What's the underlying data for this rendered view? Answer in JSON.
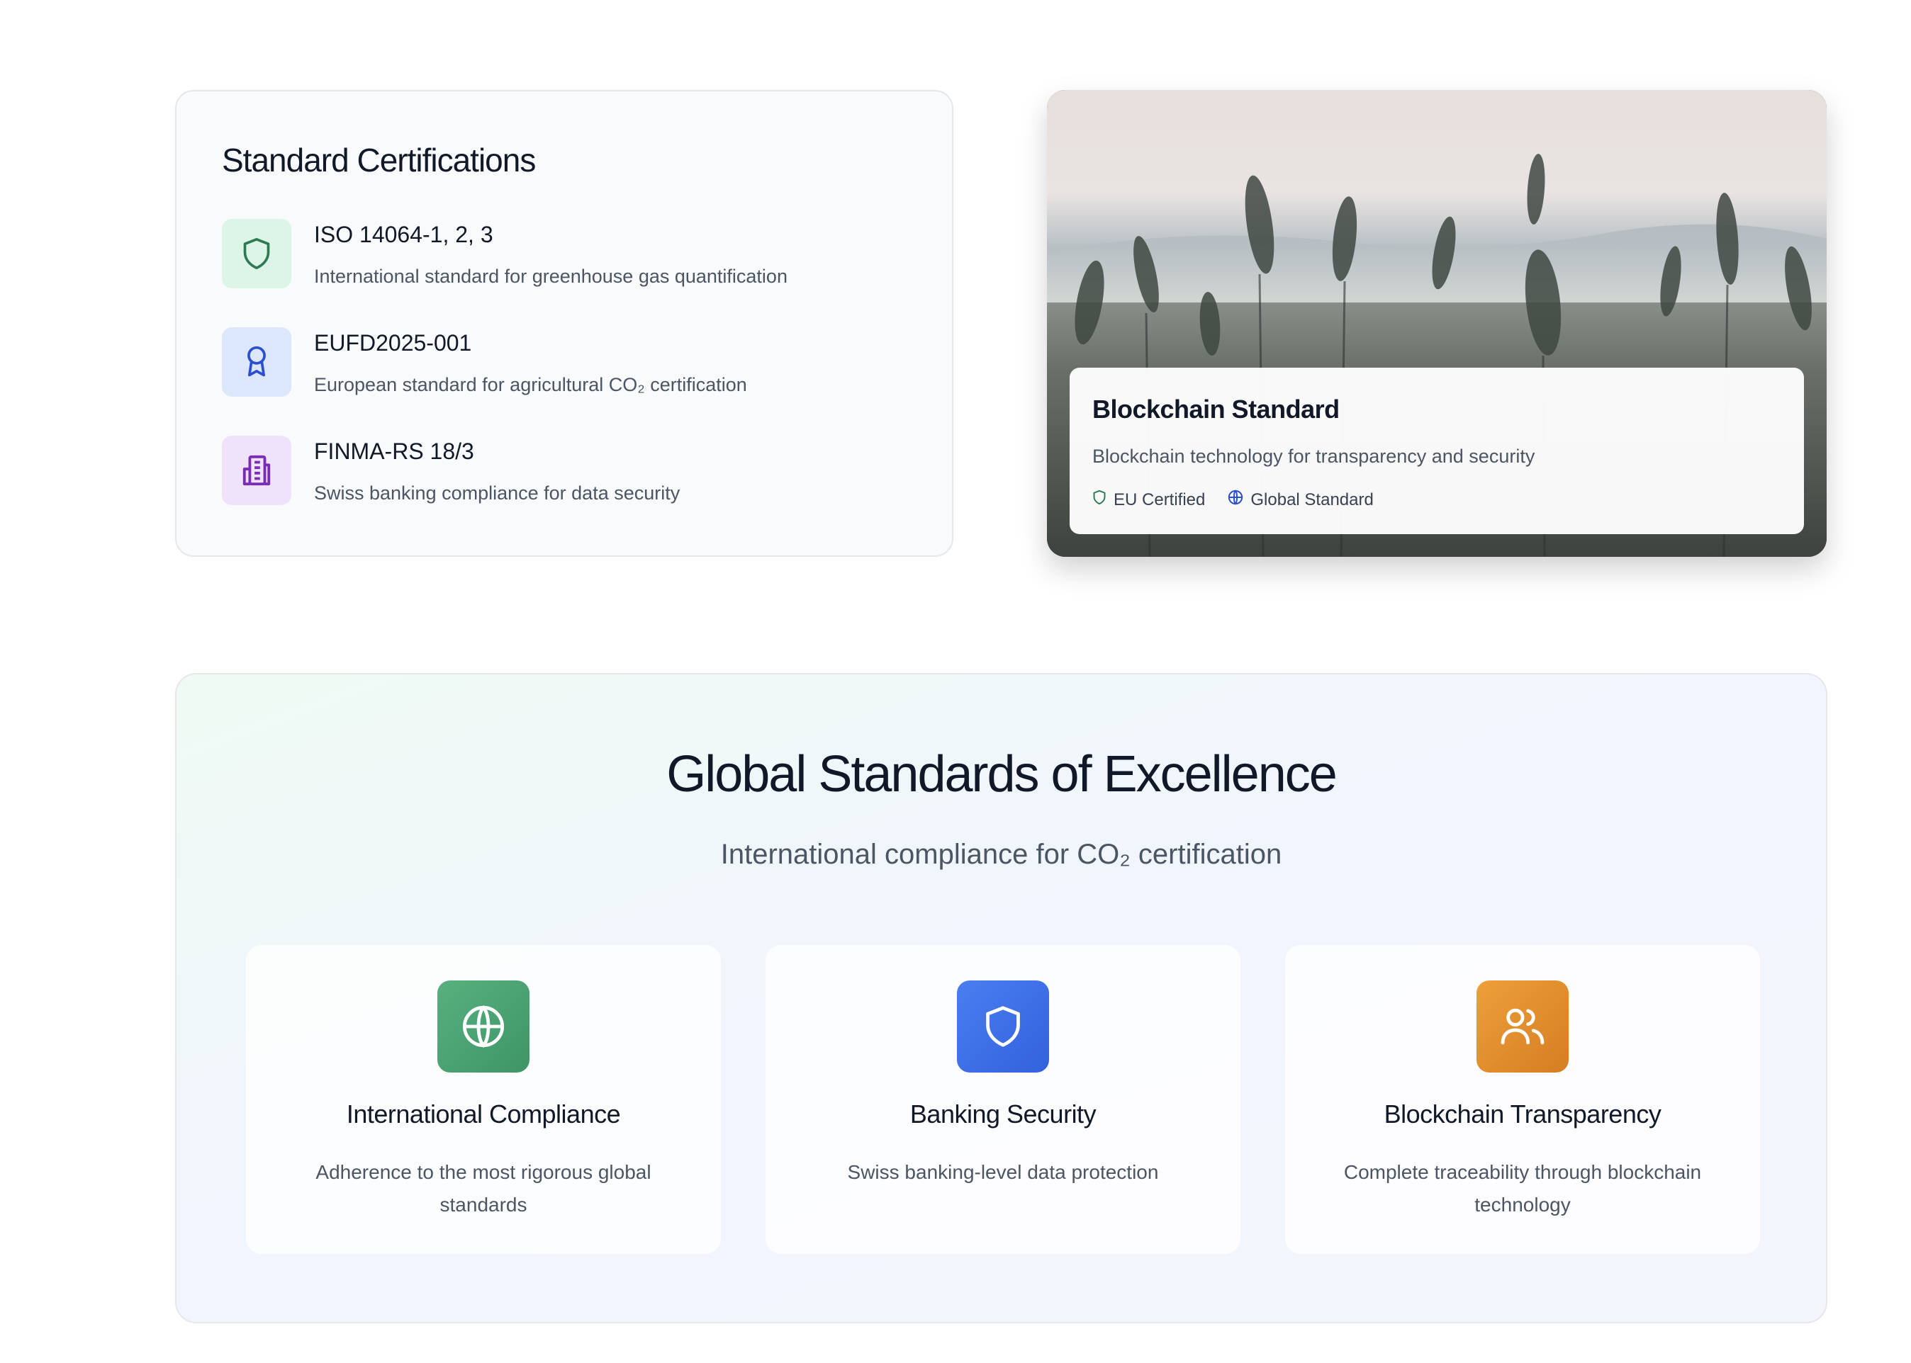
{
  "certifications": {
    "title": "Standard Certifications",
    "items": [
      {
        "name": "ISO 14064-1, 2, 3",
        "desc": "International standard for greenhouse gas quantification",
        "icon": "shield-icon",
        "color": "#2f7a55",
        "bg": "#dcf5e7"
      },
      {
        "name": "EUFD2025-001",
        "desc": "European standard for agricultural CO₂ certification",
        "icon": "award-icon",
        "color": "#2c4fcf",
        "bg": "#dde7fb"
      },
      {
        "name": "FINMA-RS 18/3",
        "desc": "Swiss banking compliance for data security",
        "icon": "building-icon",
        "color": "#7a2bb8",
        "bg": "#efe3fb"
      }
    ]
  },
  "blockchain": {
    "title": "Blockchain Standard",
    "desc": "Blockchain technology for transparency and security",
    "tags": [
      {
        "label": "EU Certified",
        "icon": "shield-icon",
        "color": "#2f7a55"
      },
      {
        "label": "Global Standard",
        "icon": "globe-icon",
        "color": "#2c4fcf"
      }
    ]
  },
  "global": {
    "title": "Global Standards of Excellence",
    "subtitle": "International compliance for CO₂ certification",
    "features": [
      {
        "title": "International Compliance",
        "desc": "Adherence to the most rigorous global standards",
        "icon": "globe-icon",
        "color": "#46a06f"
      },
      {
        "title": "Banking Security",
        "desc": "Swiss banking-level data protection",
        "icon": "shield-icon",
        "color": "#3f6fe6"
      },
      {
        "title": "Blockchain Transparency",
        "desc": "Complete traceability through blockchain technology",
        "icon": "users-icon",
        "color": "#e08b2c"
      }
    ]
  }
}
